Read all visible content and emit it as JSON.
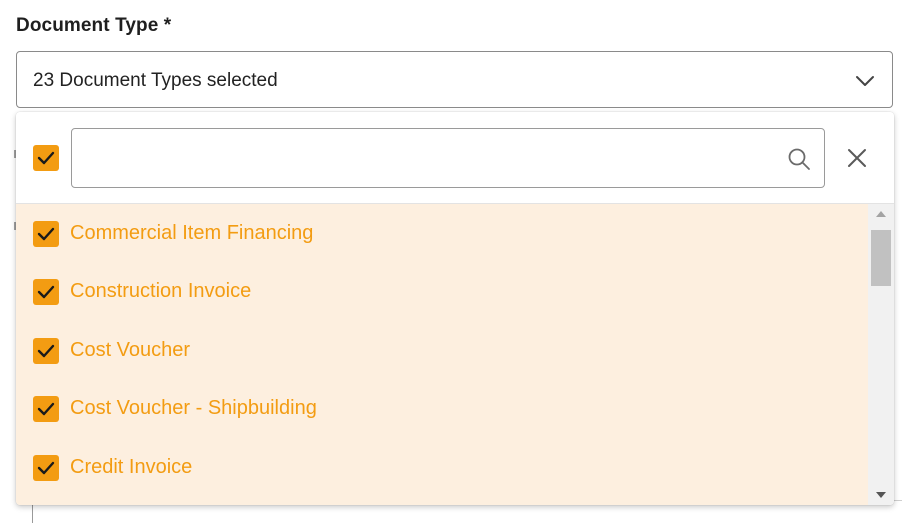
{
  "field": {
    "label": "Document Type *",
    "selected_text": "23 Document Types selected"
  },
  "dropdown": {
    "select_all_checked": true,
    "search": {
      "value": "",
      "placeholder": ""
    },
    "icons": {
      "search": "search-icon",
      "close": "close-icon",
      "chevron": "chevron-down-icon",
      "check": "checkmark-icon"
    },
    "options": [
      {
        "label": "Commercial Item Financing",
        "checked": true
      },
      {
        "label": "Construction Invoice",
        "checked": true
      },
      {
        "label": "Cost Voucher",
        "checked": true
      },
      {
        "label": "Cost Voucher - Shipbuilding",
        "checked": true
      },
      {
        "label": "Credit Invoice",
        "checked": true
      }
    ]
  },
  "colors": {
    "accent": "#f39c12",
    "selected_row_bg": "#fdefdf",
    "border": "#8a8a8a",
    "text": "#222222"
  }
}
